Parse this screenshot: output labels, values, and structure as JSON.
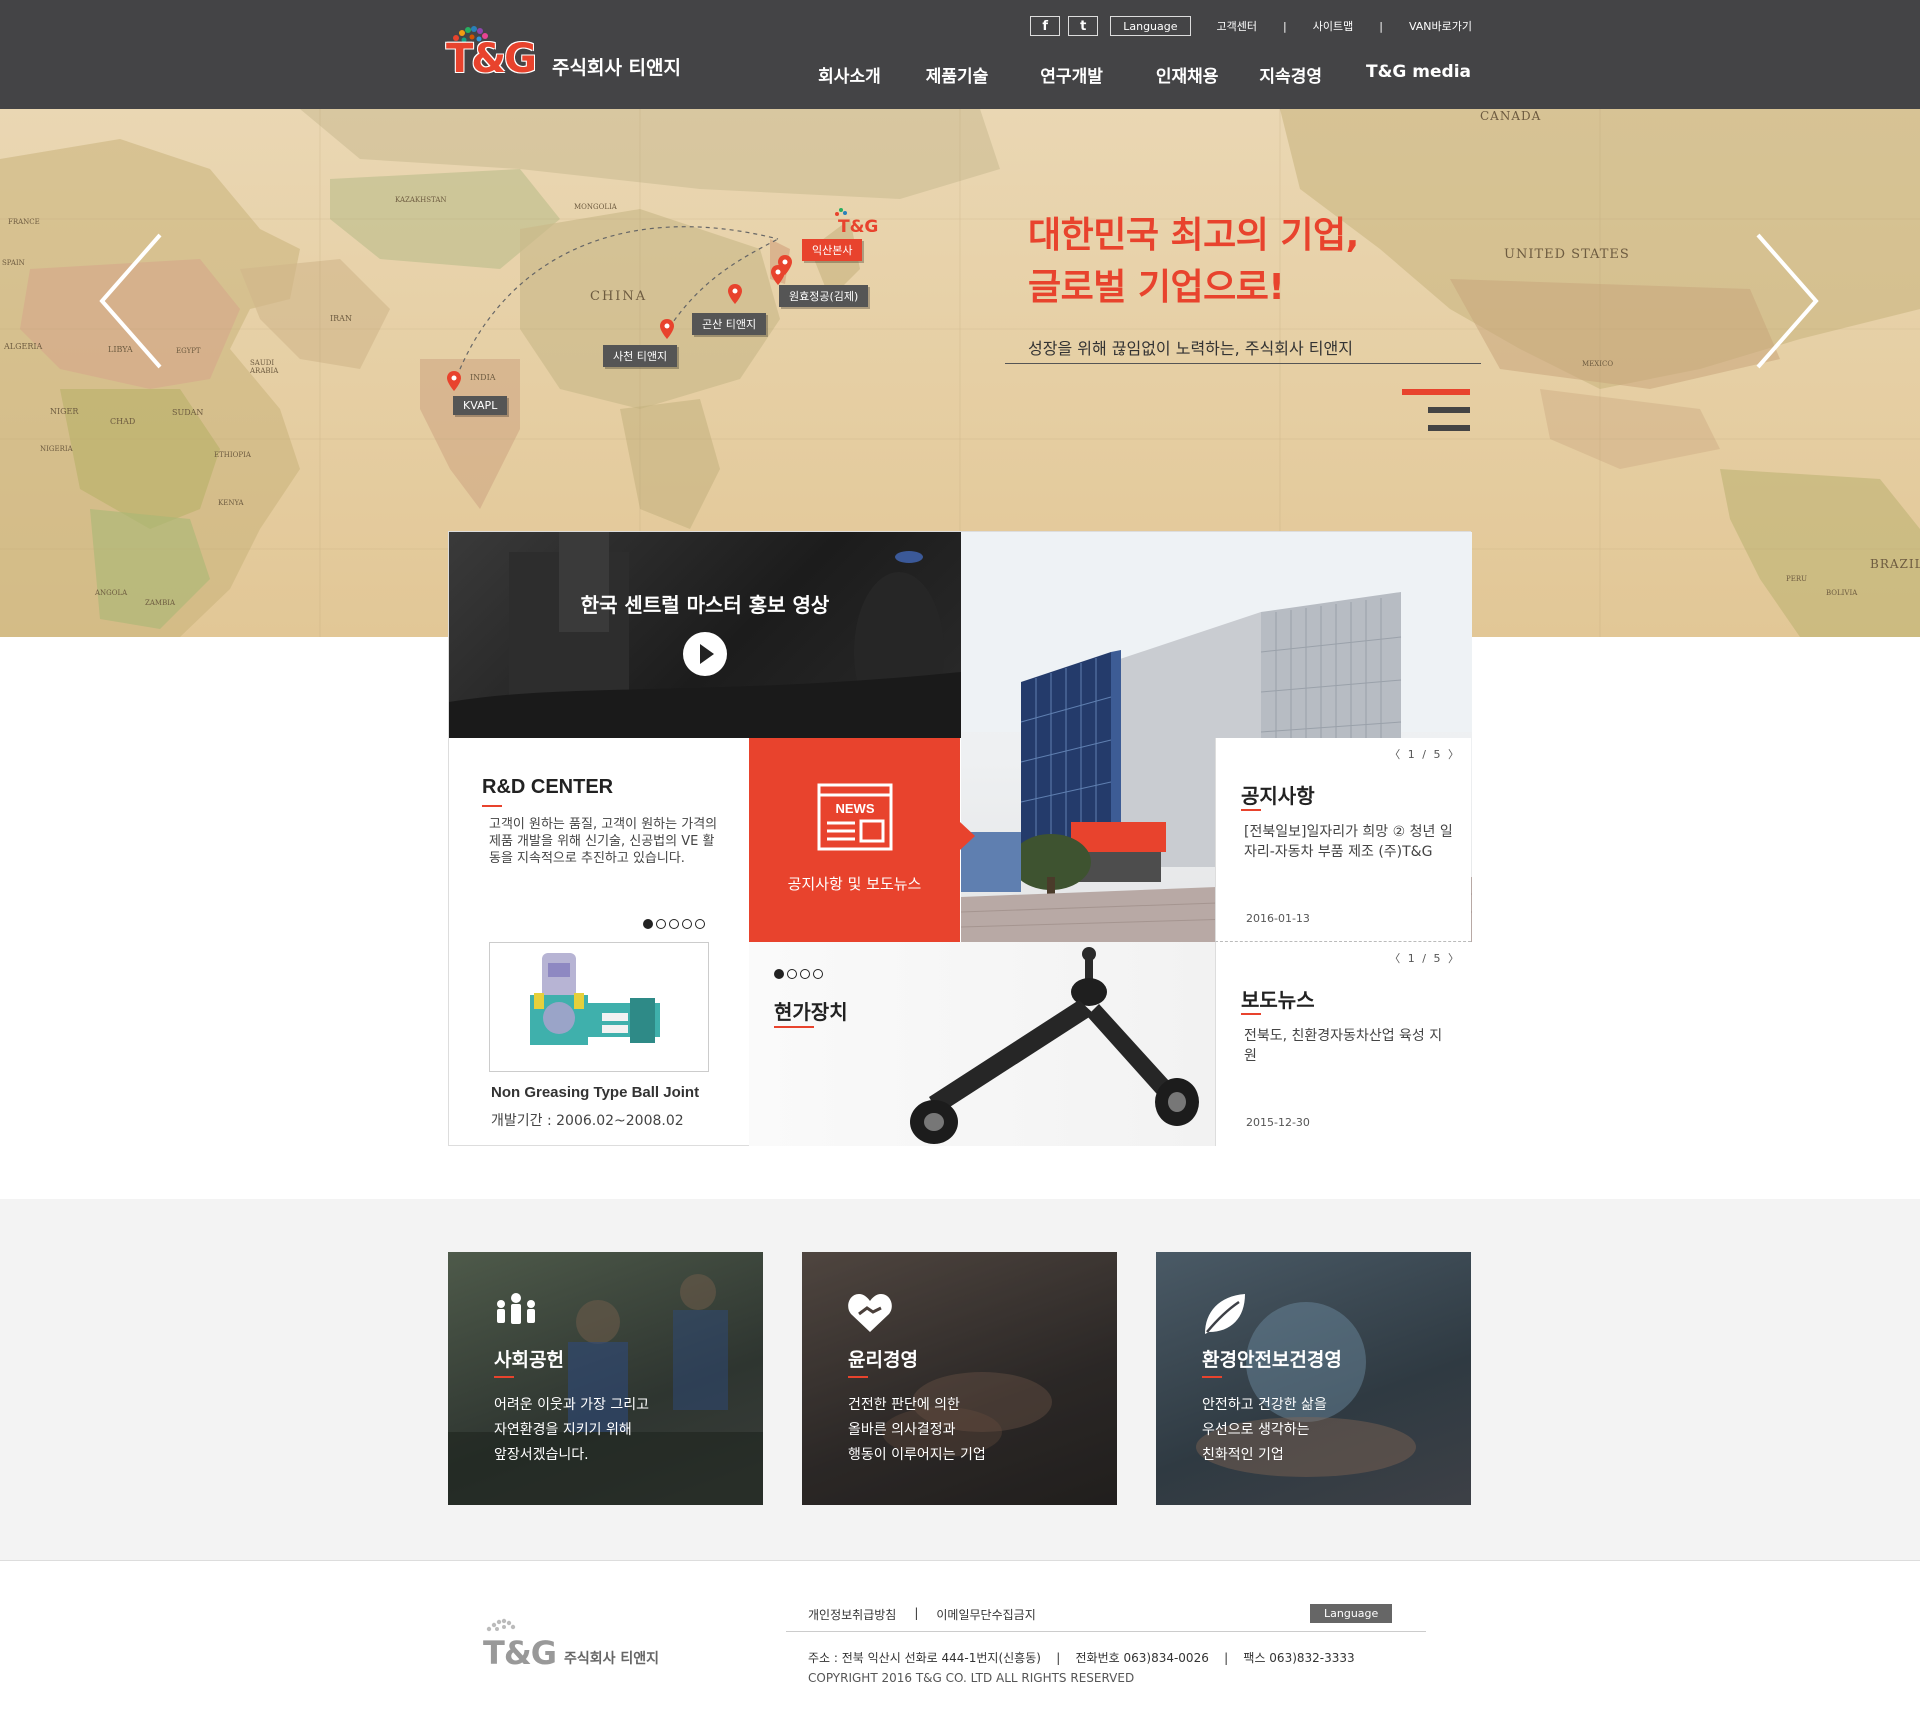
{
  "header": {
    "logo_mark": "T&G",
    "company_name": "주식회사 티앤지",
    "sns": {
      "facebook": "f",
      "twitter": "t"
    },
    "language": "Language",
    "util_links": [
      "고객센터",
      "사이트맵",
      "VAN바로가기"
    ],
    "util_separator": "|",
    "nav": [
      "회사소개",
      "제품기술",
      "연구개발",
      "인재채용",
      "지속경영",
      "T&G media"
    ]
  },
  "hero": {
    "title_line1": "대한민국 최고의 기업,",
    "title_line2": "글로벌 기업으로!",
    "subtitle": "성장을 위해 끊임없이 노력하는, 주식회사 티앤지",
    "map_logo": "T&G",
    "locations": [
      "익산본사",
      "원효정공(김제)",
      "곤산 티앤지",
      "사천 티앤지",
      "KVAPL"
    ],
    "map_labels": [
      "CANADA",
      "UNITED STATES",
      "MEXICO",
      "CHINA",
      "INDIA",
      "KAZAKHSTAN",
      "MONGOLIA",
      "IRAN",
      "ALGERIA",
      "LIBYA",
      "EGYPT",
      "SUDAN",
      "CHAD",
      "NIGER",
      "NIGERIA",
      "ETHIOPIA",
      "KENYA",
      "ANGOLA",
      "ZAMBIA",
      "SAUDI ARABIA",
      "BRAZIL",
      "PERU",
      "BOLIVIA",
      "FRANCE",
      "SPAIN"
    ],
    "colors": {
      "accent": "#e8432d",
      "bar_dark": "#444444"
    }
  },
  "video": {
    "title": "한국 센트럴 마스터 홍보 영상"
  },
  "rnd": {
    "title": "R&D CENTER",
    "description": "고객이 원하는 품질, 고객이 원하는 가격의 제품 개발을 위해 신기술, 신공법의 VE 활동을 지속적으로 추진하고 있습니다.",
    "product_name": "Non Greasing Type Ball Joint",
    "period": "개발기간 : 2006.02~2008.02"
  },
  "news_tile": {
    "icon_text": "NEWS",
    "label": "공지사항 및 보도뉴스"
  },
  "device": {
    "title": "현가장치"
  },
  "notice": {
    "pager": "〈  1 / 5  〉",
    "title": "공지사항",
    "text": "[전북일보]일자리가 희망 ② 청년 일자리-자동차 부품 제조 (주)T&G",
    "date": "2016-01-13"
  },
  "press": {
    "pager": "〈  1 / 5  〉",
    "title": "보도뉴스",
    "text": "전북도, 친환경자동차산업 육성 지원",
    "date": "2015-12-30"
  },
  "cards": [
    {
      "title": "사회공헌",
      "lines": [
        "어려운 이웃과 가장 그리고",
        "자연환경을 지키기 위해",
        "앞장서겠습니다."
      ]
    },
    {
      "title": "윤리경영",
      "lines": [
        "건전한 판단에 의한",
        "올바른 의사결정과",
        "행동이 이루어지는 기업"
      ]
    },
    {
      "title": "환경안전보건경영",
      "lines": [
        "안전하고 건강한 삶을",
        "우선으로 생각하는",
        "친화적인 기업"
      ]
    }
  ],
  "footer": {
    "logo_mark": "T&G",
    "company_name": "주식회사 티앤지",
    "links": [
      "개인정보취급방침",
      "|",
      "이메일무단수집금지"
    ],
    "language": "Language",
    "address": "주소 : 전북 익산시 선화로 444-1번지(신흥동)    |    전화번호 063)834-0026    |    팩스 063)832-3333",
    "copyright": "COPYRIGHT 2016 T&G CO. LTD ALL RIGHTS RESERVED"
  }
}
